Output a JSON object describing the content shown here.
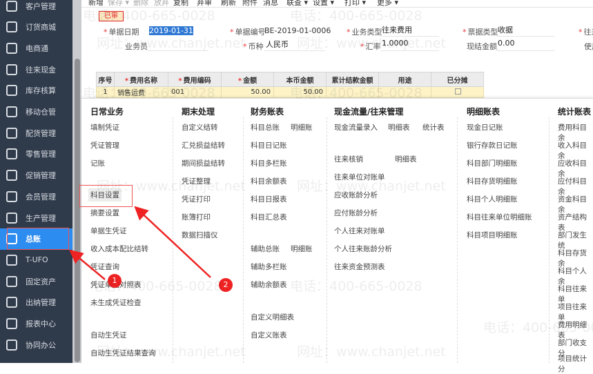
{
  "sidebar": {
    "items": [
      {
        "label": "客户管理",
        "icon": "customer-icon"
      },
      {
        "label": "订货商城",
        "icon": "mall-icon"
      },
      {
        "label": "电商通",
        "icon": "ecommerce-icon"
      },
      {
        "label": "往来现金",
        "icon": "exchange-icon"
      },
      {
        "label": "库存核算",
        "icon": "inventory-icon"
      },
      {
        "label": "移动仓管",
        "icon": "warehouse-icon"
      },
      {
        "label": "配货管理",
        "icon": "truck-icon"
      },
      {
        "label": "零售管理",
        "icon": "retail-icon"
      },
      {
        "label": "促销管理",
        "icon": "megaphone-icon"
      },
      {
        "label": "会员管理",
        "icon": "member-icon"
      },
      {
        "label": "生产管理",
        "icon": "production-icon"
      },
      {
        "label": "总账",
        "icon": "ledger-icon",
        "active": true
      },
      {
        "label": "T-UFO",
        "icon": "ufo-icon"
      },
      {
        "label": "固定资产",
        "icon": "bank-icon"
      },
      {
        "label": "出纳管理",
        "icon": "cashier-icon"
      },
      {
        "label": "报表中心",
        "icon": "pie-chart-icon"
      },
      {
        "label": "协同办公",
        "icon": "collab-icon"
      }
    ]
  },
  "toolbar": [
    "新增",
    "保存 ▾",
    "删除",
    "放弃",
    "复制",
    "弃审",
    "刷新",
    "附件",
    "消息",
    "联查 ▾",
    "设置 ▾",
    "打印 ▾",
    "更多 ▾"
  ],
  "form": {
    "status": "已审",
    "date_label": "单据日期",
    "date": "2019-01-31",
    "no_label": "单据编号",
    "no": "BE-2019-01-0006",
    "biz_type_label": "业务类型",
    "biz_type": "往来费用",
    "bill_type_label": "票据类型",
    "bill_type": "收据",
    "partner_label": "往来",
    "staff_label": "业务员",
    "staff": "",
    "currency_label": "币种",
    "currency": "人民币",
    "rate_label": "汇率",
    "rate": "1.0000",
    "cash_label": "现结金额",
    "cash": "0.00",
    "use_label": "使用"
  },
  "table": {
    "headers": [
      "序号",
      "费用名称",
      "费用编码",
      "金额",
      "本币金额",
      "累计结款金额",
      "用途",
      "已分摊"
    ],
    "rows": [
      [
        "1",
        "销售运费",
        "001",
        "50.00",
        "50.00",
        "",
        "",
        ""
      ]
    ]
  },
  "menu": {
    "columns": [
      {
        "title": "日常业务",
        "items": [
          [
            "填制凭证"
          ],
          [
            "凭证管理"
          ],
          [
            "记账"
          ],
          [
            "科目设置"
          ],
          [
            "摘要设置"
          ],
          [
            "单据生凭证"
          ],
          [
            "收入成本配比结转"
          ],
          [
            "凭证查询"
          ],
          [
            "凭证单据对照表"
          ],
          [
            "未生成凭证检查"
          ],
          [
            "自动生凭证"
          ],
          [
            "自动生凭证结果查询"
          ]
        ]
      },
      {
        "title": "期末处理",
        "items": [
          [
            "自定义结转"
          ],
          [
            "汇兑损益结转"
          ],
          [
            "期间损益结转"
          ],
          [
            "凭证整理"
          ],
          [
            "凭证打印"
          ],
          [
            "账簿打印"
          ],
          [
            "数据扫描仪"
          ]
        ]
      },
      {
        "title": "财务账表",
        "items": [
          [
            "科目总账",
            "明细账"
          ],
          [
            "科目日记账"
          ],
          [
            "科目多栏账"
          ],
          [
            "科目余额表"
          ],
          [
            "科目日报表"
          ],
          [
            "科目汇总表"
          ],
          [
            "辅助总账",
            "明细账"
          ],
          [
            "辅助多栏账"
          ],
          [
            "辅助余额表"
          ],
          [
            "自定义明细表"
          ],
          [
            "自定义账表"
          ]
        ]
      },
      {
        "title": "现金流量/往来管理",
        "items": [
          [
            "现金流量录入",
            "明细表",
            "统计表"
          ],
          [
            "往来核销",
            "明细表"
          ],
          [
            "往来单位对账单"
          ],
          [
            "应收账龄分析"
          ],
          [
            "应付账龄分析"
          ],
          [
            "个人往来对账单"
          ],
          [
            "个人往来账龄分析"
          ],
          [
            "往来资金预测表"
          ]
        ]
      },
      {
        "title": "明细账表",
        "items": [
          [
            "现金日记账"
          ],
          [
            "银行存款日记账"
          ],
          [
            "科目部门明细账"
          ],
          [
            "科目存货明细账"
          ],
          [
            "科目个人明细账"
          ],
          [
            "科目往来单位明细账"
          ],
          [
            "科目项目明细账"
          ]
        ]
      },
      {
        "title": "统计账表",
        "items": [
          [
            "费用科目余"
          ],
          [
            "收入科目余"
          ],
          [
            "应收科目余"
          ],
          [
            "应付科目余"
          ],
          [
            "资金科目余"
          ],
          [
            "资产结构表"
          ],
          [
            "部门发生统"
          ],
          [
            "科目存货余"
          ],
          [
            "科目个人余"
          ],
          [
            "科目往来单"
          ],
          [
            "项目往来单"
          ],
          [
            "费用明细表"
          ],
          [
            "部门收支分"
          ],
          [
            "项目统计分"
          ]
        ]
      }
    ]
  },
  "annotations": {
    "badge1": "1",
    "badge2": "2"
  },
  "watermark": {
    "phone": "电话：400-665-0028",
    "site": "网址：www.chanjet.net"
  },
  "colors": {
    "sidebar": "#2f3a4a",
    "active": "#2d8cf0",
    "annotation": "#e22222"
  }
}
